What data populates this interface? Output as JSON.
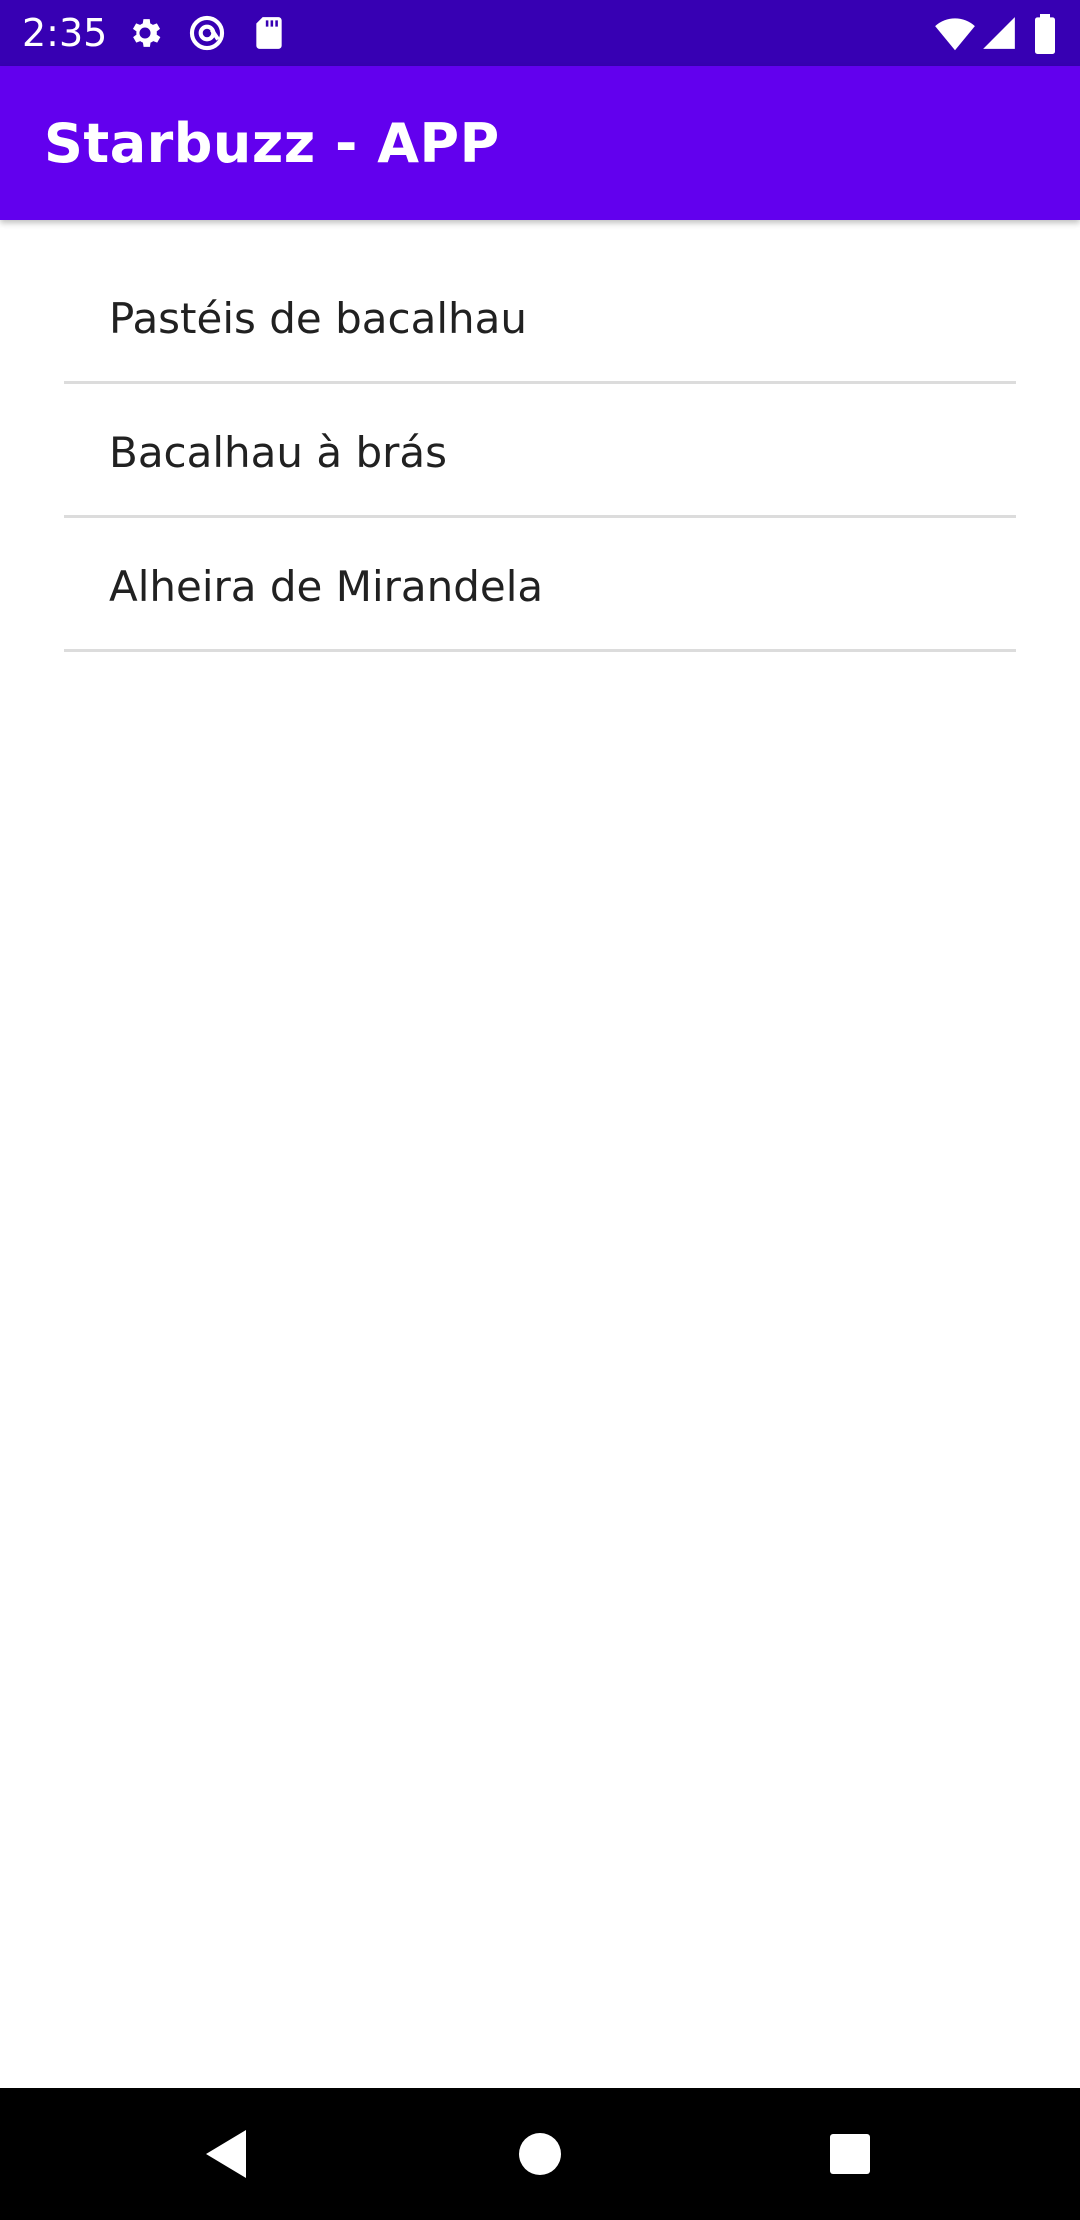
{
  "status_bar": {
    "time": "2:35",
    "left_icons": [
      "gear-icon",
      "at-sign-icon",
      "sd-card-icon"
    ],
    "right_icons": [
      "wifi-icon",
      "signal-icon",
      "battery-icon"
    ],
    "background": "#3700b3"
  },
  "app_bar": {
    "title": "Starbuzz - APP",
    "background": "#6200ee"
  },
  "list": {
    "items": [
      {
        "label": "Pastéis de bacalhau"
      },
      {
        "label": "Bacalhau à brás"
      },
      {
        "label": "Alheira de Mirandela"
      }
    ]
  },
  "nav_bar": {
    "buttons": [
      "back-icon",
      "home-icon",
      "recents-icon"
    ],
    "background": "#000000"
  }
}
